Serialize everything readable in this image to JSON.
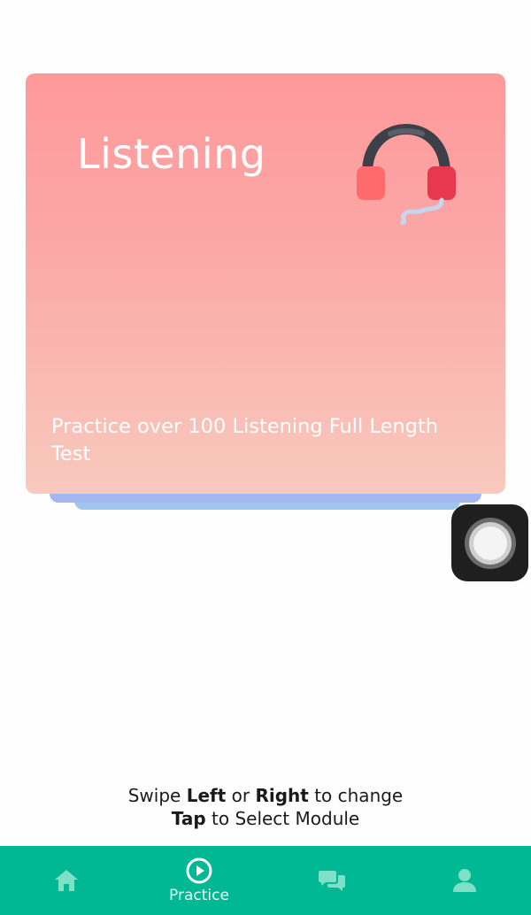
{
  "card": {
    "title": "Listening",
    "description": "Practice over 100 Listening Full Length Test",
    "icon": "headphones-icon"
  },
  "hint": {
    "line1_a": "Swipe ",
    "line1_b": "Left",
    "line1_c": " or ",
    "line1_d": "Right",
    "line1_e": " to change",
    "line2_a": "Tap",
    "line2_b": " to Select Module"
  },
  "nav": {
    "items": [
      {
        "name": "home",
        "label": "",
        "icon": "home-icon"
      },
      {
        "name": "practice",
        "label": "Practice",
        "icon": "play-circle-icon"
      },
      {
        "name": "chat",
        "label": "",
        "icon": "chat-icon"
      },
      {
        "name": "profile",
        "label": "",
        "icon": "user-icon"
      }
    ]
  },
  "colors": {
    "nav_bg": "#00b894",
    "card_top": "#fe999a",
    "card_bottom": "#f8c9bd",
    "nav_icon": "#7ee0c6"
  }
}
